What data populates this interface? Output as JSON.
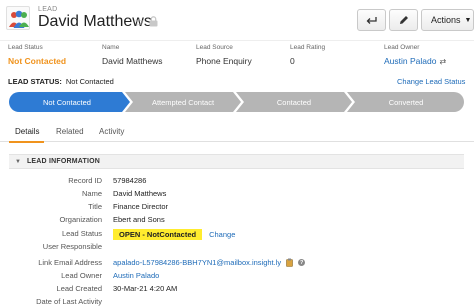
{
  "header": {
    "object_type": "LEAD",
    "record_name": "David Matthews",
    "actions_label": "Actions",
    "icons": {
      "avatar": "lead-avatar-icon",
      "star": "star-icon",
      "lock": "lock-icon",
      "back": "back-arrow-icon",
      "edit": "pencil-icon",
      "caret": "caret-down-icon"
    }
  },
  "summary": [
    {
      "label": "Lead Status",
      "value": "Not Contacted"
    },
    {
      "label": "Name",
      "value": "David Matthews"
    },
    {
      "label": "Lead Source",
      "value": "Phone Enquiry"
    },
    {
      "label": "Lead Rating",
      "value": "0"
    },
    {
      "label": "Lead Owner",
      "value": "Austin Palado"
    }
  ],
  "status": {
    "label": "LEAD STATUS:",
    "value": "Not Contacted",
    "change_link": "Change Lead Status",
    "stages": [
      {
        "label": "Not Contacted",
        "active": true
      },
      {
        "label": "Attempted Contact",
        "active": false
      },
      {
        "label": "Contacted",
        "active": false
      },
      {
        "label": "Converted",
        "active": false
      }
    ]
  },
  "tabs": [
    {
      "label": "Details",
      "active": true
    },
    {
      "label": "Related",
      "active": false
    },
    {
      "label": "Activity",
      "active": false
    }
  ],
  "section": {
    "title": "LEAD INFORMATION",
    "fields": [
      {
        "label": "Record ID",
        "value": "57984286"
      },
      {
        "label": "Name",
        "value": "David Matthews"
      },
      {
        "label": "Title",
        "value": "Finance Director"
      },
      {
        "label": "Organization",
        "value": "Ebert and Sons"
      },
      {
        "label": "Lead Status",
        "value": "OPEN - NotContacted",
        "action": "Change"
      },
      {
        "label": "User Responsible",
        "value": ""
      },
      {
        "label": "Link Email Address",
        "value": "apalado-L57984286-BBH7YN1@mailbox.insight.ly"
      },
      {
        "label": "Lead Owner",
        "value": "Austin Palado"
      },
      {
        "label": "Lead Created",
        "value": "30-Mar-21 4:20 AM"
      },
      {
        "label": "Date of Last Activity",
        "value": ""
      }
    ]
  },
  "colors": {
    "accent": "#f0931d",
    "link": "#1e6bb8",
    "active_stage": "#2e7bd4",
    "inactive_stage": "#b5b5b5",
    "status_highlight": "#ffec2e"
  }
}
